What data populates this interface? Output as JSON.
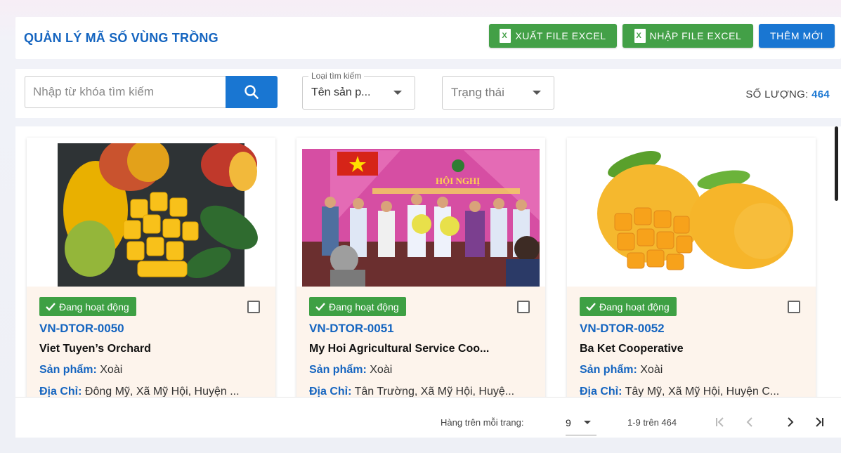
{
  "header": {
    "title": "QUẢN LÝ MÃ SỐ VÙNG TRỒNG",
    "export_label": "XUẤT FILE EXCEL",
    "import_label": "NHẬP FILE EXCEL",
    "add_label": "THÊM MỚI",
    "file_icon_letter": "X"
  },
  "filters": {
    "search_placeholder": "Nhập từ khóa tìm kiếm",
    "search_type_label": "Loại tìm kiếm",
    "search_type_value": "Tên sản p...",
    "status_placeholder": "Trạng thái",
    "count_label": "SỐ LƯỢNG:",
    "count_value": "464"
  },
  "cards": [
    {
      "status": "Đang hoạt động",
      "code": "VN-DTOR-0050",
      "name": "Viet Tuyen’s Orchard",
      "product_label": "Sản phẩm:",
      "product": "Xoài",
      "address_label": "Địa Chỉ:",
      "address": "Đông Mỹ, Xã Mỹ Hội, Huyện ..."
    },
    {
      "status": "Đang hoạt động",
      "code": "VN-DTOR-0051",
      "name": "My Hoi Agricultural Service Coo...",
      "product_label": "Sản phẩm:",
      "product": "Xoài",
      "address_label": "Địa Chỉ:",
      "address": "Tân Trường, Xã Mỹ Hội, Huyệ...",
      "banner_title": "HỘI NGHỊ"
    },
    {
      "status": "Đang hoạt động",
      "code": "VN-DTOR-0052",
      "name": "Ba Ket Cooperative",
      "product_label": "Sản phẩm:",
      "product": "Xoài",
      "address_label": "Địa Chỉ:",
      "address": "Tây Mỹ, Xã Mỹ Hội, Huyện C..."
    }
  ],
  "pagination": {
    "rows_label": "Hàng trên mỗi trang:",
    "rows_value": "9",
    "range": "1-9 trên 464"
  },
  "colors": {
    "primary": "#1976d2",
    "success": "#43a047",
    "title": "#1565c0",
    "card_body": "#fdf4ec"
  },
  "icons": [
    "file-excel-icon",
    "search-icon",
    "caret-down-icon",
    "check-icon",
    "checkbox-icon",
    "first-page-icon",
    "prev-page-icon",
    "next-page-icon",
    "last-page-icon"
  ]
}
